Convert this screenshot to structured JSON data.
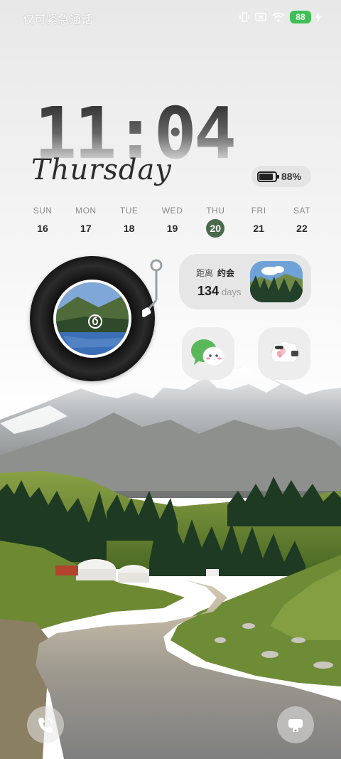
{
  "status_bar": {
    "text": "仅可紧急通话",
    "battery_level": "88",
    "icons": [
      "vibrate-icon",
      "no-sim-icon",
      "wifi-icon",
      "battery-icon",
      "charging-icon"
    ]
  },
  "clock": {
    "time": "11:04",
    "weekday": "Thursday"
  },
  "battery_widget": {
    "percent_label": "88%",
    "level": 0.88
  },
  "week": {
    "days": [
      {
        "name": "SUN",
        "date": "16"
      },
      {
        "name": "MON",
        "date": "17"
      },
      {
        "name": "TUE",
        "date": "18"
      },
      {
        "name": "WED",
        "date": "19"
      },
      {
        "name": "THU",
        "date": "20"
      },
      {
        "name": "FRI",
        "date": "21"
      },
      {
        "name": "SAT",
        "date": "22"
      }
    ],
    "today_index": 4
  },
  "countdown": {
    "prefix": "距离",
    "event": "约会",
    "count": "134",
    "unit": "days"
  },
  "apps": [
    {
      "name": "wechat",
      "icon": "wechat-icon"
    },
    {
      "name": "mask",
      "icon": "cloud-mask-icon"
    }
  ],
  "shortcuts": {
    "left": "phone-icon",
    "right": "camera-icon"
  },
  "colors": {
    "today_highlight": "#4a6a4a",
    "battery_green": "#3fbf55",
    "widget_bg": "#e6e6e6"
  }
}
